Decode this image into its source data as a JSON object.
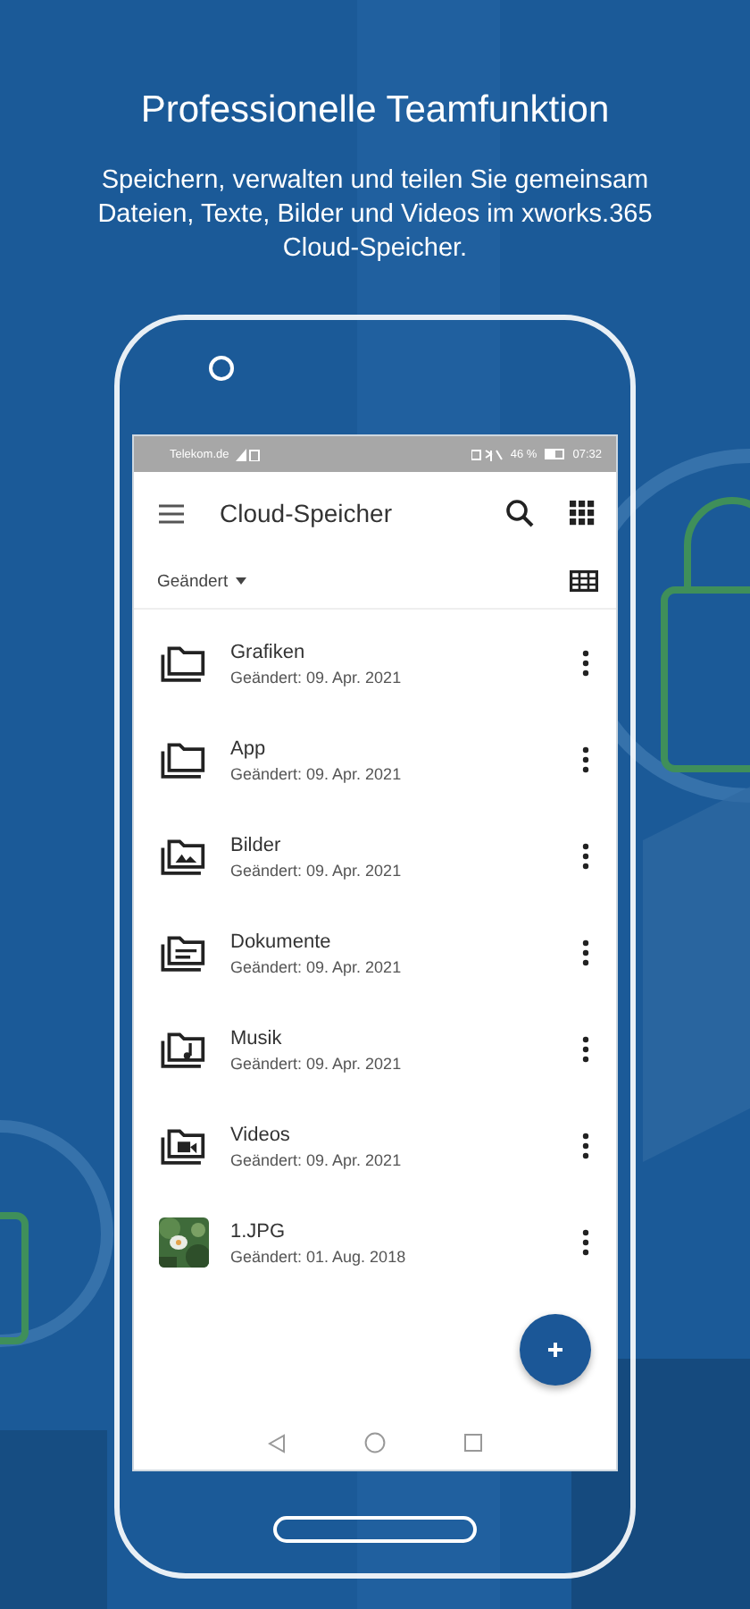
{
  "header": {
    "title": "Professionelle Teamfunktion",
    "subtitle": "Speichern, verwalten und teilen Sie gemeinsam Dateien, Texte, Bilder und Videos im xworks.365 Cloud-Speicher."
  },
  "status_bar": {
    "carrier": "Telekom.de",
    "battery": "46 %",
    "time": "07:32"
  },
  "app_bar": {
    "title": "Cloud-Speicher"
  },
  "sort": {
    "label": "Geändert"
  },
  "files": [
    {
      "kind": "folder",
      "name": "Grafiken",
      "modified": "Geändert: 09. Apr. 2021"
    },
    {
      "kind": "folder",
      "name": "App",
      "modified": "Geändert: 09. Apr. 2021"
    },
    {
      "kind": "images",
      "name": "Bilder",
      "modified": "Geändert: 09. Apr. 2021"
    },
    {
      "kind": "documents",
      "name": "Dokumente",
      "modified": "Geändert: 09. Apr. 2021"
    },
    {
      "kind": "music",
      "name": "Musik",
      "modified": "Geändert: 09. Apr. 2021"
    },
    {
      "kind": "videos",
      "name": "Videos",
      "modified": "Geändert: 09. Apr. 2021"
    },
    {
      "name": "1.JPG",
      "modified": "Geändert: 01. Aug. 2018"
    }
  ]
}
